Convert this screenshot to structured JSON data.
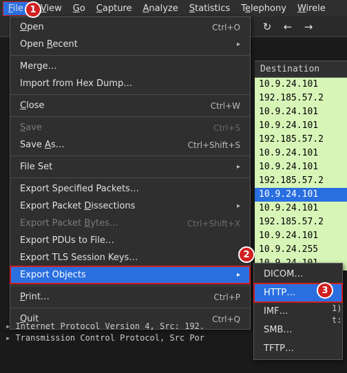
{
  "menubar": {
    "items": [
      {
        "label": "File",
        "accel": "F",
        "active": true
      },
      {
        "label": "t",
        "plain": true
      },
      {
        "label": "View",
        "accel": "V"
      },
      {
        "label": "Go",
        "accel": "G"
      },
      {
        "label": "Capture",
        "accel": "C"
      },
      {
        "label": "Analyze",
        "accel": "A"
      },
      {
        "label": "Statistics",
        "accel": "S"
      },
      {
        "label": "Telephony",
        "accel": "e",
        "accel_index": 1
      },
      {
        "label": "Wirele",
        "accel": "W",
        "cut": true
      }
    ]
  },
  "toolbar": {
    "refresh_icon": "↻",
    "back_icon": "←",
    "fwd_icon": "→"
  },
  "file_menu": {
    "items": [
      {
        "label": "Open",
        "accel": "O",
        "shortcut": "Ctrl+O"
      },
      {
        "label": "Open Recent",
        "accel": "R",
        "accel_index": 5,
        "submenu": true
      },
      {
        "sep": true
      },
      {
        "label": "Merge…"
      },
      {
        "label": "Import from Hex Dump…"
      },
      {
        "sep": true
      },
      {
        "label": "Close",
        "accel": "C",
        "shortcut": "Ctrl+W"
      },
      {
        "sep": true
      },
      {
        "label": "Save",
        "accel": "S",
        "shortcut": "Ctrl+S",
        "disabled": true
      },
      {
        "label": "Save As…",
        "accel": "A",
        "accel_index": 5,
        "shortcut": "Ctrl+Shift+S"
      },
      {
        "sep": true
      },
      {
        "label": "File Set",
        "submenu": true
      },
      {
        "sep": true
      },
      {
        "label": "Export Specified Packets…"
      },
      {
        "label": "Export Packet Dissections",
        "accel": "D",
        "accel_index": 14,
        "submenu": true
      },
      {
        "label": "Export Packet Bytes…",
        "accel": "B",
        "accel_index": 14,
        "shortcut": "Ctrl+Shift+X",
        "disabled": true
      },
      {
        "label": "Export PDUs to File…"
      },
      {
        "label": "Export TLS Session Keys…"
      },
      {
        "label": "Export Objects",
        "submenu": true,
        "selected": true,
        "boxed": true,
        "badge": "2"
      },
      {
        "sep": true
      },
      {
        "label": "Print…",
        "accel": "P",
        "shortcut": "Ctrl+P"
      },
      {
        "sep": true
      },
      {
        "label": "Quit",
        "accel": "Q",
        "shortcut": "Ctrl+Q"
      }
    ]
  },
  "submenu_export": {
    "items": [
      {
        "label": "DICOM…"
      },
      {
        "label": "HTTP…",
        "selected": true,
        "badge": "3"
      },
      {
        "label": "IMF…"
      },
      {
        "label": "SMB…"
      },
      {
        "label": "TFTP…"
      }
    ]
  },
  "table": {
    "header": "Destination",
    "rows": [
      {
        "v": "10.9.24.101"
      },
      {
        "v": "192.185.57.2"
      },
      {
        "v": "10.9.24.101"
      },
      {
        "v": "10.9.24.101"
      },
      {
        "v": "192.185.57.2"
      },
      {
        "v": "10.9.24.101"
      },
      {
        "v": "10.9.24.101"
      },
      {
        "v": "192.185.57.2"
      },
      {
        "v": "10.9.24.101",
        "sel": true
      },
      {
        "v": "10.9.24.101"
      },
      {
        "v": "192.185.57.2"
      },
      {
        "v": "10.9.24.101"
      },
      {
        "v": "10.9.24.255"
      },
      {
        "v": "10.9.24.101"
      }
    ]
  },
  "right_fragments": [
    "1)",
    "t:"
  ],
  "details": {
    "lines": [
      "Internet Protocol Version 4, Src: 192.",
      "Transmission Control Protocol, Src Por"
    ]
  },
  "badges": {
    "file": "1",
    "export_objects": "2",
    "http": "3"
  }
}
